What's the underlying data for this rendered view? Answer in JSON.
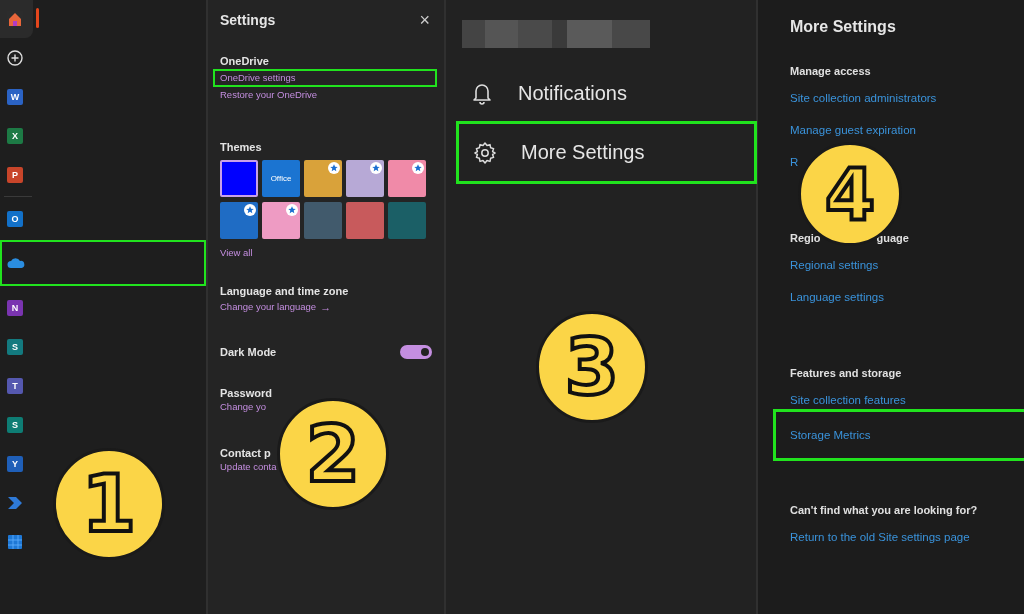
{
  "app_rail": {
    "items": [
      {
        "kind": "home",
        "selected": true,
        "highlighted": false
      },
      {
        "kind": "add",
        "selected": false,
        "highlighted": false
      },
      {
        "kind": "letter",
        "letter": "W",
        "color": "#2b63c4",
        "selected": false,
        "highlighted": false
      },
      {
        "kind": "letter",
        "letter": "X",
        "color": "#1d7a45",
        "selected": false,
        "highlighted": false
      },
      {
        "kind": "letter",
        "letter": "P",
        "color": "#c8452a",
        "selected": false,
        "highlighted": false
      },
      {
        "kind": "divider"
      },
      {
        "kind": "letter",
        "letter": "O",
        "color": "#1271c9",
        "selected": false,
        "highlighted": false
      },
      {
        "kind": "cloud",
        "selected": false,
        "highlighted": true
      },
      {
        "kind": "letter",
        "letter": "N",
        "color": "#7a34b0",
        "selected": false,
        "highlighted": false
      },
      {
        "kind": "letter",
        "letter": "S",
        "color": "#137a7f",
        "selected": false,
        "highlighted": false
      },
      {
        "kind": "letter",
        "letter": "T",
        "color": "#5558af",
        "selected": false,
        "highlighted": false
      },
      {
        "kind": "letter",
        "letter": "S",
        "color": "#0e7d74",
        "selected": false,
        "highlighted": false
      },
      {
        "kind": "letter",
        "letter": "Y",
        "color": "#1f5fb8",
        "selected": false,
        "highlighted": false
      },
      {
        "kind": "chevron",
        "selected": false,
        "highlighted": false
      },
      {
        "kind": "tiles",
        "selected": false,
        "highlighted": false
      }
    ]
  },
  "settings_panel": {
    "title": "Settings",
    "close": "×",
    "onedrive": {
      "heading": "OneDrive",
      "links": [
        {
          "text": "OneDrive settings",
          "highlighted": true
        },
        {
          "text": "Restore your OneDrive",
          "highlighted": false
        }
      ]
    },
    "themes": {
      "heading": "Themes",
      "tiles": [
        {
          "kind": "color",
          "color": "#0000ff",
          "selected": true,
          "star": false
        },
        {
          "kind": "label",
          "label": "Office",
          "color": "#1b74d1",
          "selected": false,
          "star": false
        },
        {
          "kind": "picture",
          "color": "#d9a23a",
          "selected": false,
          "star": true
        },
        {
          "kind": "picture",
          "color": "#b7a9d6",
          "selected": false,
          "star": true
        },
        {
          "kind": "picture",
          "color": "#f08aa8",
          "selected": false,
          "star": true
        },
        {
          "kind": "picture",
          "color": "#1f6cc4",
          "selected": false,
          "star": true
        },
        {
          "kind": "picture",
          "color": "#ee9bc3",
          "selected": false,
          "star": true
        },
        {
          "kind": "picture",
          "color": "#415a6c",
          "selected": false,
          "star": false
        },
        {
          "kind": "picture",
          "color": "#c85a5c",
          "selected": false,
          "star": false
        },
        {
          "kind": "picture",
          "color": "#1b5f66",
          "selected": false,
          "star": false
        }
      ],
      "view_all": "View all"
    },
    "language": {
      "heading": "Language and time zone",
      "link": "Change your language",
      "arrow": "→"
    },
    "dark_mode": {
      "label": "Dark Mode",
      "on": true
    },
    "password": {
      "heading": "Password",
      "link": "Change yo"
    },
    "contact": {
      "heading": "Contact p",
      "link": "Update conta"
    }
  },
  "account_menu": {
    "items": [
      {
        "kind": "bell",
        "label": "Notifications",
        "highlighted": false
      },
      {
        "kind": "gear",
        "label": "More Settings",
        "highlighted": true
      }
    ]
  },
  "more_settings": {
    "title": "More Settings",
    "sections": [
      {
        "heading": [
          "Manage access"
        ],
        "links": [
          {
            "text": "Site collection administrators",
            "highlighted": false
          },
          {
            "text": "Manage guest expiration",
            "highlighted": false
          },
          {
            "text": "R",
            "highlighted": false
          }
        ]
      },
      {
        "heading": [
          "Regio",
          "guage"
        ],
        "links": [
          {
            "text": "Regional settings",
            "highlighted": false
          },
          {
            "text": "Language settings",
            "highlighted": false
          }
        ]
      },
      {
        "heading": [
          "Features and storage"
        ],
        "links": [
          {
            "text": "Site collection features",
            "highlighted": false
          },
          {
            "text": "Storage Metrics",
            "highlighted": true
          }
        ]
      },
      {
        "heading": [
          "Can't find what you are looking for?"
        ],
        "links": [
          {
            "text": "Return to the old Site settings page",
            "highlighted": false
          }
        ]
      }
    ]
  },
  "step_badges": [
    {
      "label": "1"
    },
    {
      "label": "2"
    },
    {
      "label": "3"
    },
    {
      "label": "4"
    }
  ]
}
